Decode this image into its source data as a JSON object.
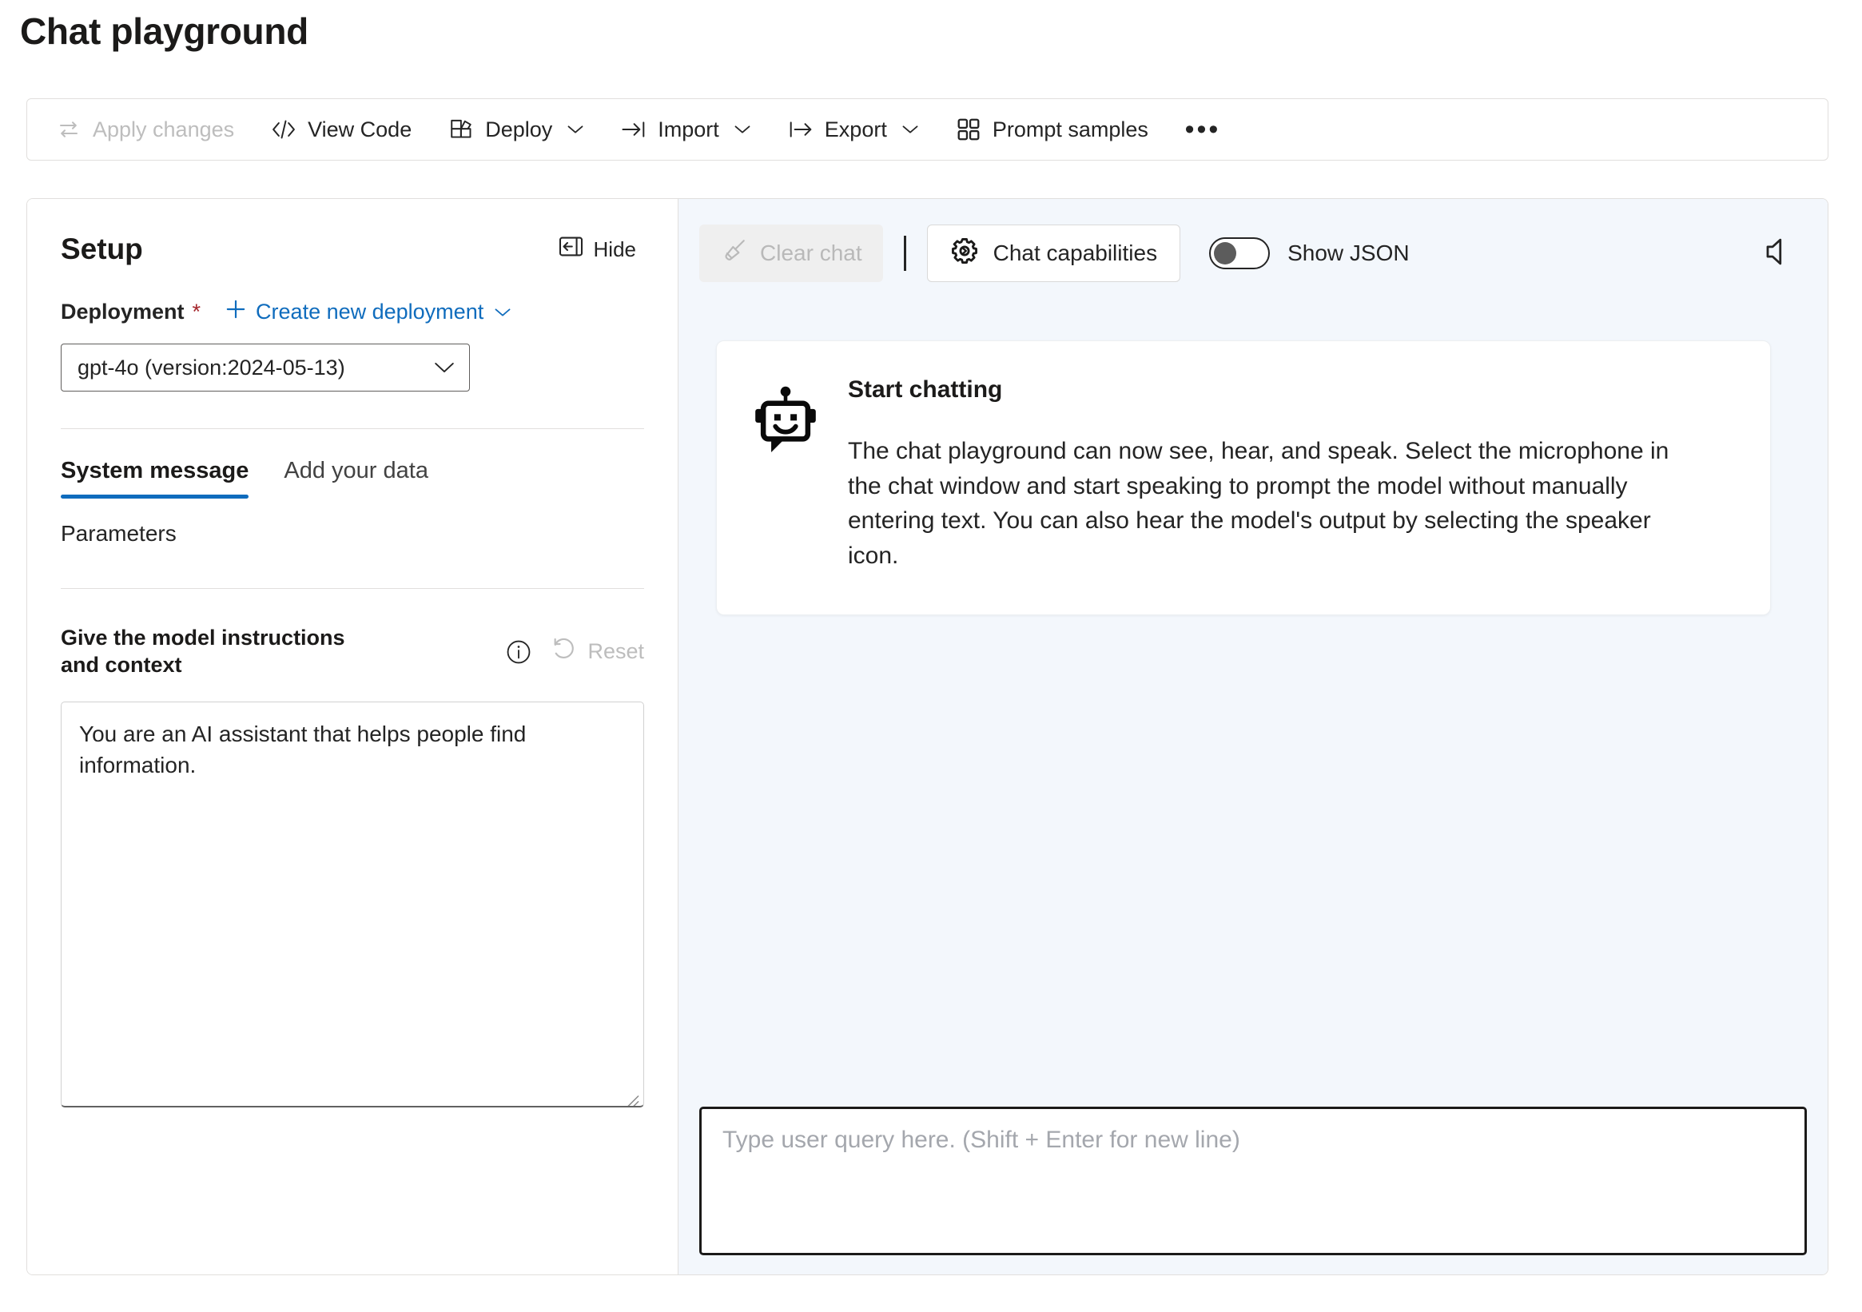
{
  "page": {
    "title": "Chat playground"
  },
  "command_bar": {
    "items": [
      {
        "label": "Apply changes",
        "icon": "apply-changes-icon",
        "disabled": true,
        "has_chevron": false
      },
      {
        "label": "View Code",
        "icon": "code-icon",
        "disabled": false,
        "has_chevron": false
      },
      {
        "label": "Deploy",
        "icon": "deploy-icon",
        "disabled": false,
        "has_chevron": true
      },
      {
        "label": "Import",
        "icon": "import-icon",
        "disabled": false,
        "has_chevron": true
      },
      {
        "label": "Export",
        "icon": "export-icon",
        "disabled": false,
        "has_chevron": true
      },
      {
        "label": "Prompt samples",
        "icon": "grid-icon",
        "disabled": false,
        "has_chevron": false
      }
    ],
    "overflow_label": "•••"
  },
  "setup": {
    "title": "Setup",
    "hide_label": "Hide",
    "deployment": {
      "label": "Deployment",
      "required_marker": "*",
      "create_link": "Create new deployment",
      "selected_value": "gpt-4o (version:2024-05-13)"
    },
    "tabs": [
      {
        "label": "System message",
        "active": true
      },
      {
        "label": "Add your data",
        "active": false
      }
    ],
    "parameters_label": "Parameters",
    "system_message": {
      "heading": "Give the model instructions and context",
      "reset_label": "Reset",
      "value": "You are an AI assistant that helps people find information."
    }
  },
  "chat": {
    "toolbar": {
      "clear_chat_label": "Clear chat",
      "chat_capabilities_label": "Chat capabilities",
      "show_json_label": "Show JSON",
      "show_json_enabled": false,
      "speaker_icon": "speaker-icon"
    },
    "start_card": {
      "icon": "bot-icon",
      "title": "Start chatting",
      "text": "The chat playground can now see, hear, and speak. Select the microphone in the chat window and start speaking to prompt the model without manually entering text. You can also hear the model's output by selecting the speaker icon."
    },
    "query_input": {
      "placeholder": "Type user query here. (Shift + Enter for new line)",
      "value": ""
    }
  },
  "colors": {
    "accent": "#0f6cbd",
    "required": "#a4262c",
    "chat_background": "#f3f7fc",
    "text": "#242424",
    "disabled": "#bdbdbd"
  }
}
